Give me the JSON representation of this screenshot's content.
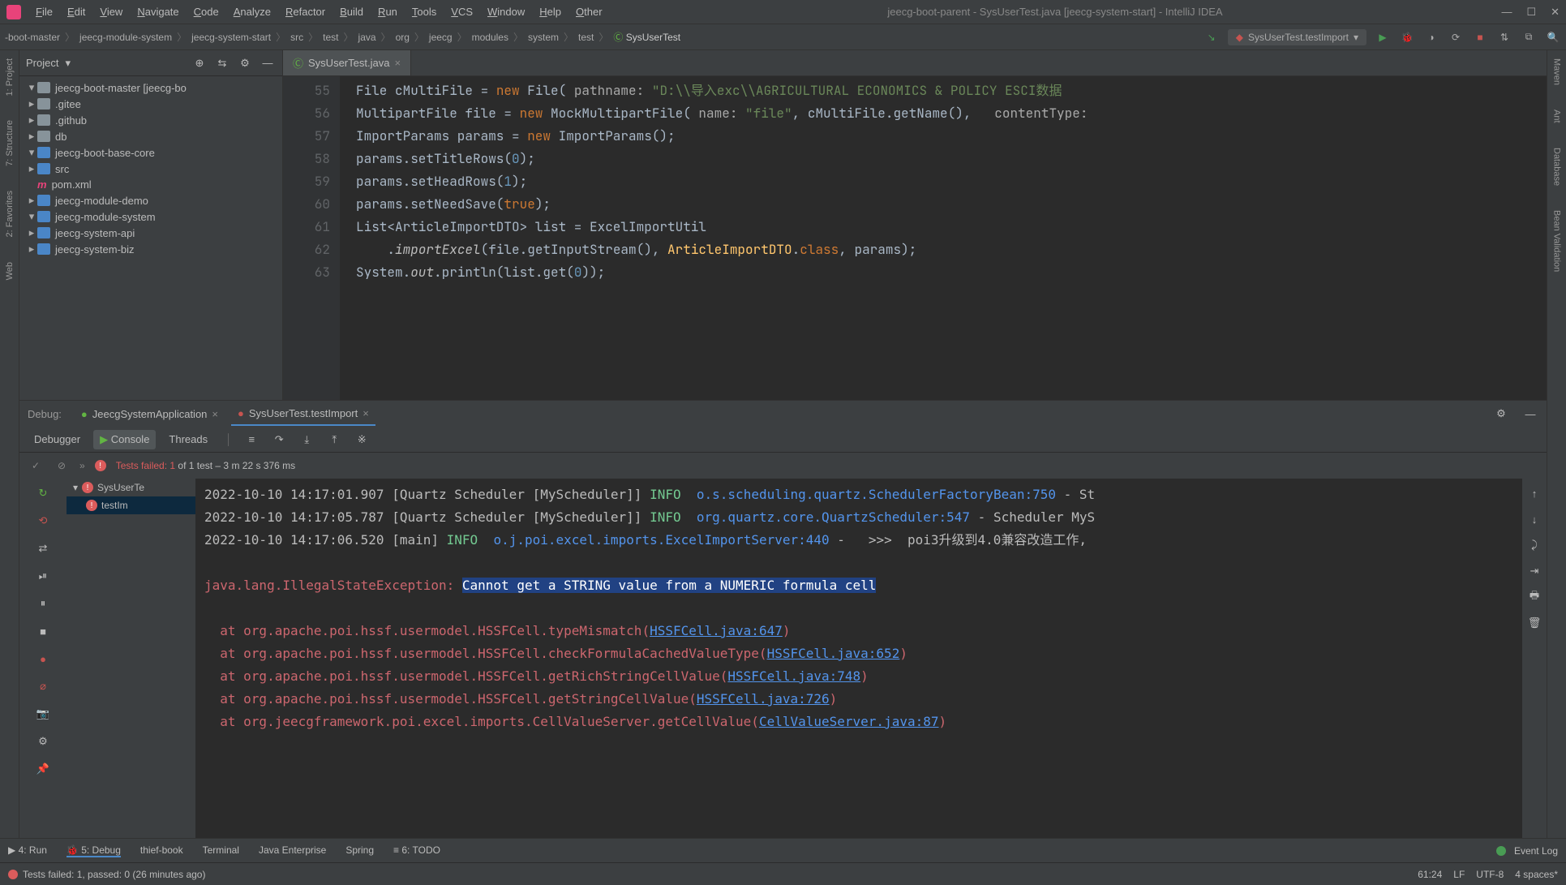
{
  "window": {
    "title": "jeecg-boot-parent - SysUserTest.java [jeecg-system-start] - IntelliJ IDEA",
    "menus": [
      "File",
      "Edit",
      "View",
      "Navigate",
      "Code",
      "Analyze",
      "Refactor",
      "Build",
      "Run",
      "Tools",
      "VCS",
      "Window",
      "Help",
      "Other"
    ]
  },
  "breadcrumb": [
    "-boot-master",
    "jeecg-module-system",
    "jeecg-system-start",
    "src",
    "test",
    "java",
    "org",
    "jeecg",
    "modules",
    "system",
    "test",
    "SysUserTest"
  ],
  "run_config": "SysUserTest.testImport",
  "left_rail": [
    "1: Project",
    "7: Structure",
    "2: Favorites",
    "Web"
  ],
  "right_rail": [
    "Maven",
    "Ant",
    "Database",
    "Bean Validation"
  ],
  "project": {
    "title": "Project",
    "tree": [
      {
        "l": 0,
        "open": true,
        "icon": "folder",
        "text": "jeecg-boot-master [jeecg-bo"
      },
      {
        "l": 1,
        "open": false,
        "icon": "folder",
        "text": ".gitee"
      },
      {
        "l": 1,
        "open": false,
        "icon": "folder",
        "text": ".github"
      },
      {
        "l": 1,
        "open": false,
        "icon": "folder",
        "text": "db"
      },
      {
        "l": 1,
        "open": true,
        "icon": "folder-blue",
        "text": "jeecg-boot-base-core"
      },
      {
        "l": 2,
        "open": false,
        "icon": "folder-blue",
        "text": "src"
      },
      {
        "l": 2,
        "open": null,
        "icon": "pom",
        "text": "pom.xml"
      },
      {
        "l": 1,
        "open": false,
        "icon": "folder-blue",
        "text": "jeecg-module-demo"
      },
      {
        "l": 1,
        "open": true,
        "icon": "folder-blue",
        "text": "jeecg-module-system"
      },
      {
        "l": 2,
        "open": false,
        "icon": "folder-blue",
        "text": "jeecg-system-api"
      },
      {
        "l": 2,
        "open": false,
        "icon": "folder-blue",
        "text": "jeecg-system-biz"
      }
    ]
  },
  "editor": {
    "tab": "SysUserTest.java",
    "gutter": [
      "55",
      "56",
      "57",
      "58",
      "59",
      "60",
      "61",
      "62",
      "63"
    ],
    "code": [
      [
        {
          "t": "File cMultiFile = ",
          "c": "type"
        },
        {
          "t": "new ",
          "c": "kw"
        },
        {
          "t": "File( ",
          "c": "type"
        },
        {
          "t": "pathname: ",
          "c": "param"
        },
        {
          "t": "\"D:\\\\导入exc\\\\AGRICULTURAL ECONOMICS & POLICY ESCI数据",
          "c": "str"
        }
      ],
      [
        {
          "t": "MultipartFile file = ",
          "c": "type"
        },
        {
          "t": "new ",
          "c": "kw"
        },
        {
          "t": "MockMultipartFile( ",
          "c": "type"
        },
        {
          "t": "name: ",
          "c": "param"
        },
        {
          "t": "\"file\"",
          "c": "str"
        },
        {
          "t": ", cMultiFile.getName(),   ",
          "c": "type"
        },
        {
          "t": "contentType:",
          "c": "param"
        }
      ],
      [
        {
          "t": "ImportParams params = ",
          "c": "type"
        },
        {
          "t": "new ",
          "c": "kw"
        },
        {
          "t": "ImportParams();",
          "c": "type"
        }
      ],
      [
        {
          "t": "params.setTitleRows(",
          "c": "type"
        },
        {
          "t": "0",
          "c": "num"
        },
        {
          "t": ");",
          "c": "type"
        }
      ],
      [
        {
          "t": "params.setHeadRows(",
          "c": "type"
        },
        {
          "t": "1",
          "c": "num"
        },
        {
          "t": ");",
          "c": "type"
        }
      ],
      [
        {
          "t": "params.setNeedSave(",
          "c": "type"
        },
        {
          "t": "true",
          "c": "kw"
        },
        {
          "t": ");",
          "c": "type"
        }
      ],
      [
        {
          "t": "List<ArticleImportDTO> list = ExcelImportUtil",
          "c": "type"
        }
      ],
      [
        {
          "t": "    .",
          "c": "type"
        },
        {
          "t": "importExcel",
          "c": "ital"
        },
        {
          "t": "(file.getInputStream(), ",
          "c": "type"
        },
        {
          "t": "ArticleImportDTO",
          "c": "fn"
        },
        {
          "t": ".",
          "c": "type"
        },
        {
          "t": "class",
          "c": "kw"
        },
        {
          "t": ", params);",
          "c": "type"
        }
      ],
      [
        {
          "t": "System.",
          "c": "type"
        },
        {
          "t": "out",
          "c": "ital"
        },
        {
          "t": ".println(list.get(",
          "c": "type"
        },
        {
          "t": "0",
          "c": "num"
        },
        {
          "t": "));",
          "c": "type"
        }
      ]
    ]
  },
  "debug": {
    "label": "Debug:",
    "tabs": [
      {
        "label": "JeecgSystemApplication",
        "sel": false
      },
      {
        "label": "SysUserTest.testImport",
        "sel": true
      }
    ],
    "sub": [
      "Debugger",
      "Console",
      "Threads"
    ],
    "sub_sel": 1,
    "tests_status": {
      "prefix": "Tests failed: 1",
      "suffix": " of 1 test – 3 m 22 s 376 ms"
    },
    "test_tree": [
      {
        "label": "SysUserTe",
        "err": true,
        "sel": false,
        "indent": 0
      },
      {
        "label": "testIm",
        "err": true,
        "sel": true,
        "indent": 1
      }
    ],
    "console": [
      [
        {
          "t": "2022-10-10 14:17:01.907 [Quartz Scheduler [MyScheduler]] "
        },
        {
          "t": "INFO ",
          "c": "c-green"
        },
        {
          "t": " "
        },
        {
          "t": "o.s.scheduling.quartz.SchedulerFactoryBean:750",
          "c": "c-cyan"
        },
        {
          "t": " - St"
        }
      ],
      [
        {
          "t": "2022-10-10 14:17:05.787 [Quartz Scheduler [MyScheduler]] "
        },
        {
          "t": "INFO ",
          "c": "c-green"
        },
        {
          "t": " "
        },
        {
          "t": "org.quartz.core.QuartzScheduler:547",
          "c": "c-cyan"
        },
        {
          "t": " - Scheduler MyS"
        }
      ],
      [
        {
          "t": "2022-10-10 14:17:06.520 [main] "
        },
        {
          "t": "INFO ",
          "c": "c-green"
        },
        {
          "t": " "
        },
        {
          "t": "o.j.poi.excel.imports.ExcelImportServer:440",
          "c": "c-cyan"
        },
        {
          "t": " -   >>>  poi3升级到4.0兼容改造工作,"
        }
      ],
      [
        {
          "t": " "
        }
      ],
      [
        {
          "t": "java.lang.IllegalStateException: ",
          "c": "c-red"
        },
        {
          "t": "Cannot get a STRING value from a NUMERIC formula cell",
          "c": "c-red hl"
        }
      ],
      [
        {
          "t": " "
        }
      ],
      [
        {
          "t": "  at org.apache.poi.hssf.usermodel.HSSFCell.typeMismatch(",
          "c": "c-red"
        },
        {
          "t": "HSSFCell.java:647",
          "c": "c-link"
        },
        {
          "t": ")",
          "c": "c-red"
        }
      ],
      [
        {
          "t": "  at org.apache.poi.hssf.usermodel.HSSFCell.checkFormulaCachedValueType(",
          "c": "c-red"
        },
        {
          "t": "HSSFCell.java:652",
          "c": "c-link"
        },
        {
          "t": ")",
          "c": "c-red"
        }
      ],
      [
        {
          "t": "  at org.apache.poi.hssf.usermodel.HSSFCell.getRichStringCellValue(",
          "c": "c-red"
        },
        {
          "t": "HSSFCell.java:748",
          "c": "c-link"
        },
        {
          "t": ")",
          "c": "c-red"
        }
      ],
      [
        {
          "t": "  at org.apache.poi.hssf.usermodel.HSSFCell.getStringCellValue(",
          "c": "c-red"
        },
        {
          "t": "HSSFCell.java:726",
          "c": "c-link"
        },
        {
          "t": ")",
          "c": "c-red"
        }
      ],
      [
        {
          "t": "  at org.jeecgframework.poi.excel.imports.CellValueServer.getCellValue(",
          "c": "c-red"
        },
        {
          "t": "CellValueServer.java:87",
          "c": "c-link"
        },
        {
          "t": ")",
          "c": "c-red"
        }
      ]
    ]
  },
  "tools": {
    "items": [
      "▶ 4: Run",
      "🐞 5: Debug",
      "thief-book",
      "Terminal",
      "Java Enterprise",
      "Spring",
      "≡ 6: TODO"
    ],
    "event_log": "Event Log"
  },
  "footer": {
    "status": "Tests failed: 1, passed: 0 (26 minutes ago)",
    "right": [
      "61:24",
      "LF",
      "UTF-8",
      "4 spaces*"
    ]
  }
}
